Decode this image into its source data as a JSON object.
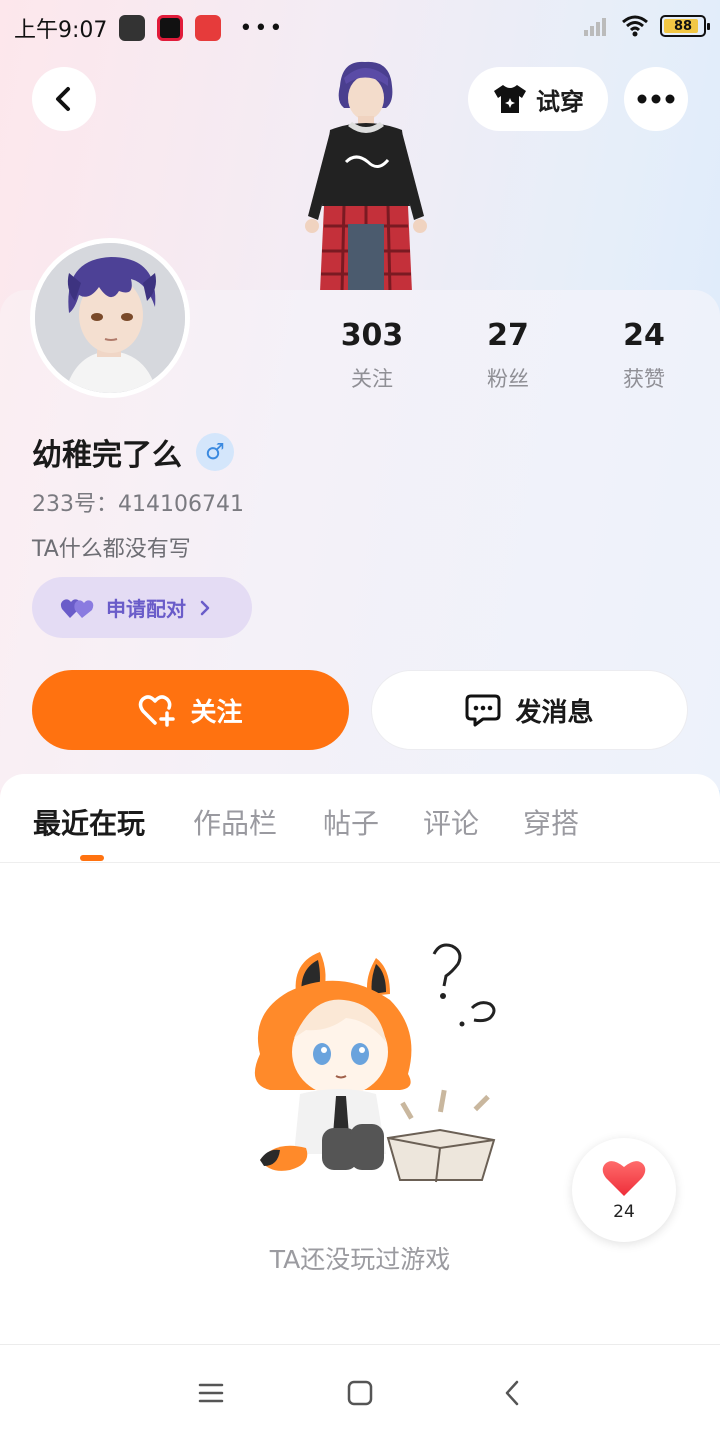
{
  "status_bar": {
    "time": "上午9:07",
    "dots": "•••",
    "battery": "88"
  },
  "header": {
    "tryon_label": "试穿"
  },
  "profile": {
    "stats": [
      {
        "value": "303",
        "label": "关注"
      },
      {
        "value": "27",
        "label": "粉丝"
      },
      {
        "value": "24",
        "label": "获赞"
      }
    ],
    "username": "幼稚完了么",
    "gender_symbol": "♂",
    "user_id": "233号：414106741",
    "bio": "TA什么都没有写",
    "pair_label": "申请配对"
  },
  "actions": {
    "follow_label": "关注",
    "message_label": "发消息"
  },
  "tabs": [
    "最近在玩",
    "作品栏",
    "帖子",
    "评论",
    "穿搭"
  ],
  "empty_state": {
    "text": "TA还没玩过游戏"
  },
  "like_float": {
    "count": "24"
  },
  "colors": {
    "accent": "#ff7210",
    "pair_bg": "#e4dcf4",
    "pair_text": "#6a5cc9",
    "gender_blue": "#3b8ae0"
  }
}
